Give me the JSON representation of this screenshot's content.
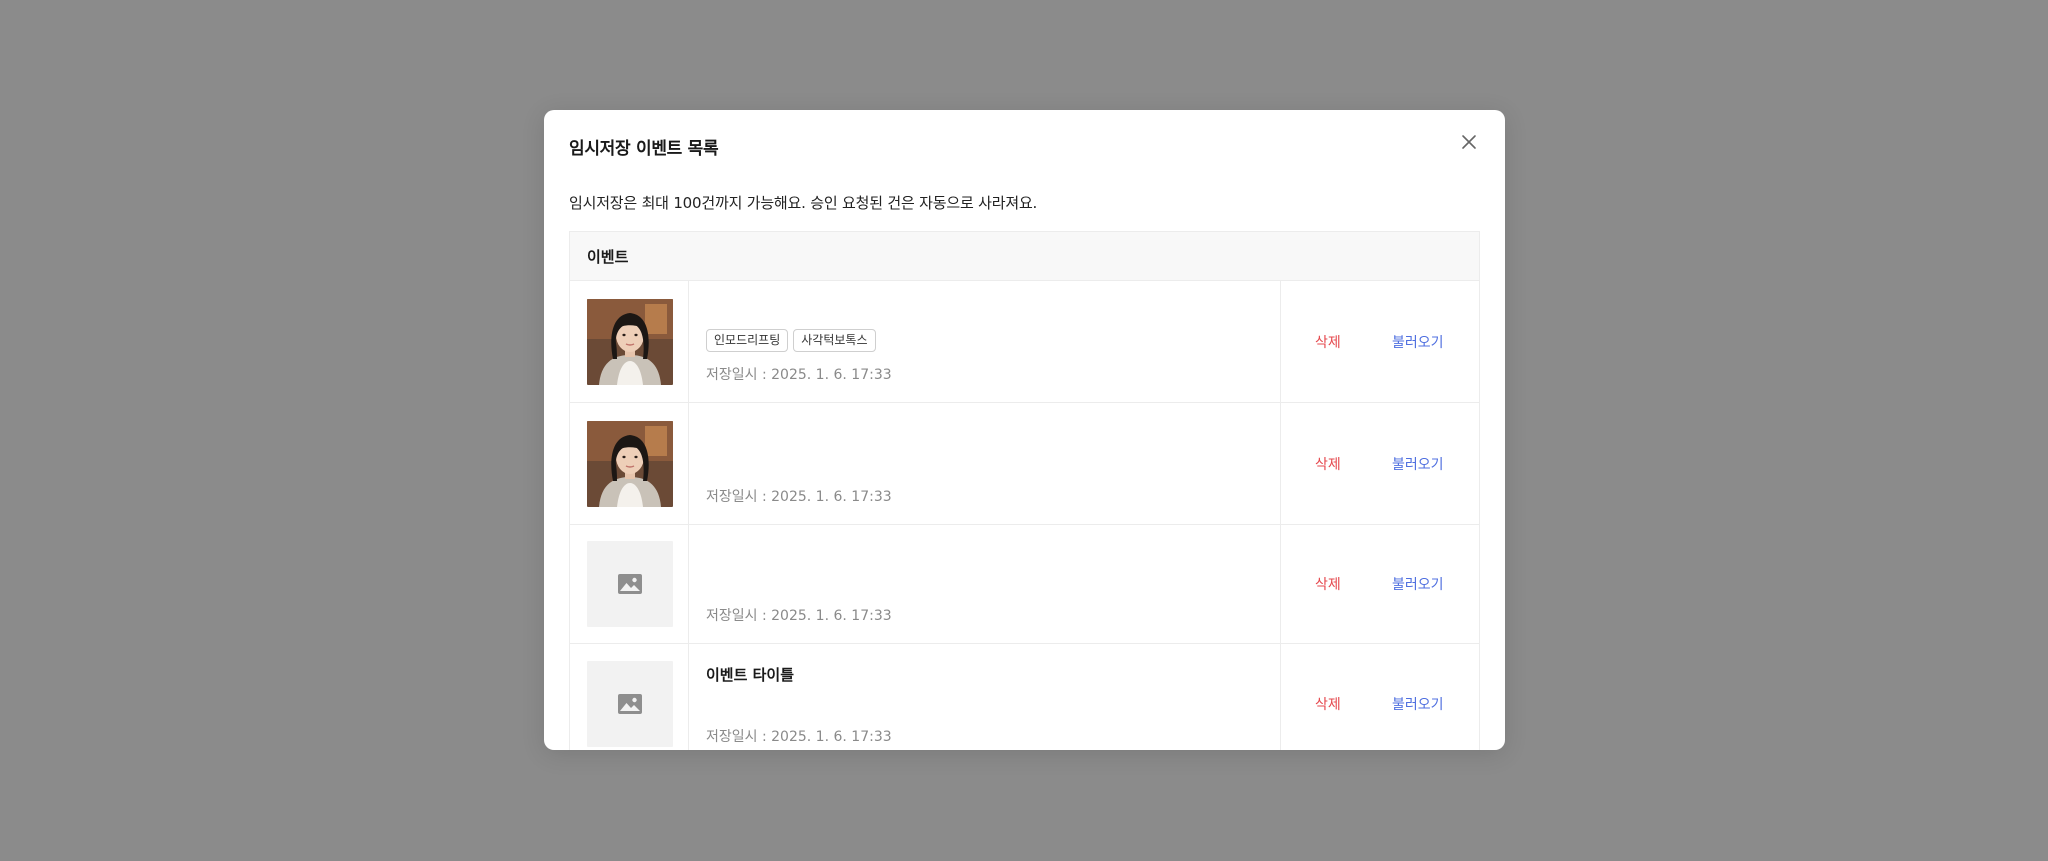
{
  "modal": {
    "title": "임시저장 이벤트 목록",
    "notice": "임시저장은 최대 100건까지 가능해요. 승인 요청된 건은 자동으로 사라져요.",
    "close_icon": "close-icon"
  },
  "table": {
    "header": "이벤트",
    "rows": [
      {
        "thumbnail": "photo",
        "title": "",
        "tags": [
          "인모드리프팅",
          "사각턱보톡스"
        ],
        "saved": "저장일시 : 2025. 1. 6. 17:33",
        "delete_label": "삭제",
        "load_label": "불러오기"
      },
      {
        "thumbnail": "photo",
        "title": "",
        "tags": [],
        "saved": "저장일시 : 2025. 1. 6. 17:33",
        "delete_label": "삭제",
        "load_label": "불러오기"
      },
      {
        "thumbnail": "image-placeholder-icon",
        "title": "",
        "tags": [],
        "saved": "저장일시 : 2025. 1. 6. 17:33",
        "delete_label": "삭제",
        "load_label": "불러오기"
      },
      {
        "thumbnail": "image-placeholder-icon",
        "title": "이벤트 타이틀",
        "tags": [],
        "saved": "저장일시 : 2025. 1. 6. 17:33",
        "delete_label": "삭제",
        "load_label": "불러오기"
      }
    ]
  },
  "colors": {
    "overlay": "#8b8b8b",
    "delete": "#e5484d",
    "load": "#4f6fe0"
  }
}
